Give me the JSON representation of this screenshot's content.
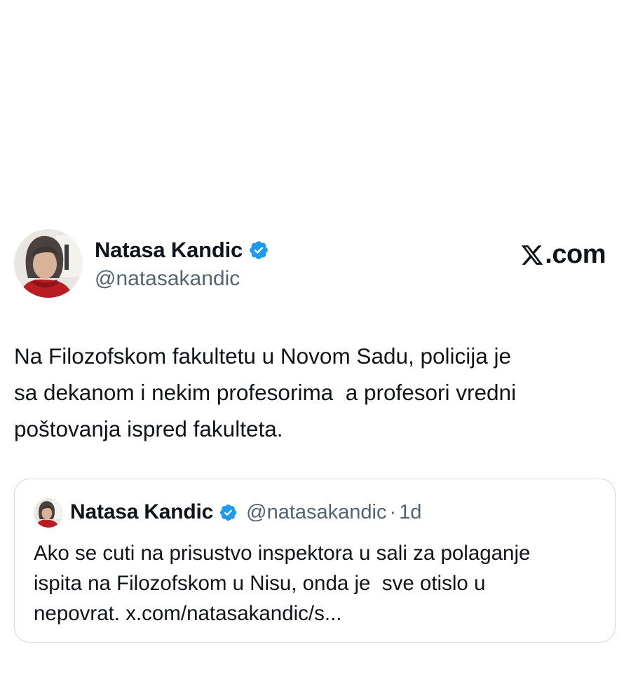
{
  "author": {
    "name": "Natasa Kandic",
    "handle": "@natasakandic",
    "verified": true,
    "avatar_icon": "woman-portrait-avatar"
  },
  "brand": {
    "label": ".com",
    "logo_icon": "x-logo-icon"
  },
  "tweet": {
    "text": "Na Filozofskom fakultetu u Novom Sadu, policija je\nsa dekanom i nekim profesorima  a profesori vredni\npoštovanja ispred fakulteta."
  },
  "quoted_tweet": {
    "author_name": "Natasa Kandic",
    "handle": "@natasakandic",
    "separator": "·",
    "time": "1d",
    "text_lines": [
      "Ako se cuti na prisustvo inspektora u sali za polaganje",
      "ispita na Filozofskom u Nisu, onda je  sve otislo u"
    ],
    "text_tail": "nepovrat. ",
    "link": "x.com/natasakandic/s..."
  },
  "colors": {
    "text": "#0f1419",
    "secondary_text": "#536471",
    "verified_blue": "#1d9bf0",
    "border": "#cfd9de"
  }
}
